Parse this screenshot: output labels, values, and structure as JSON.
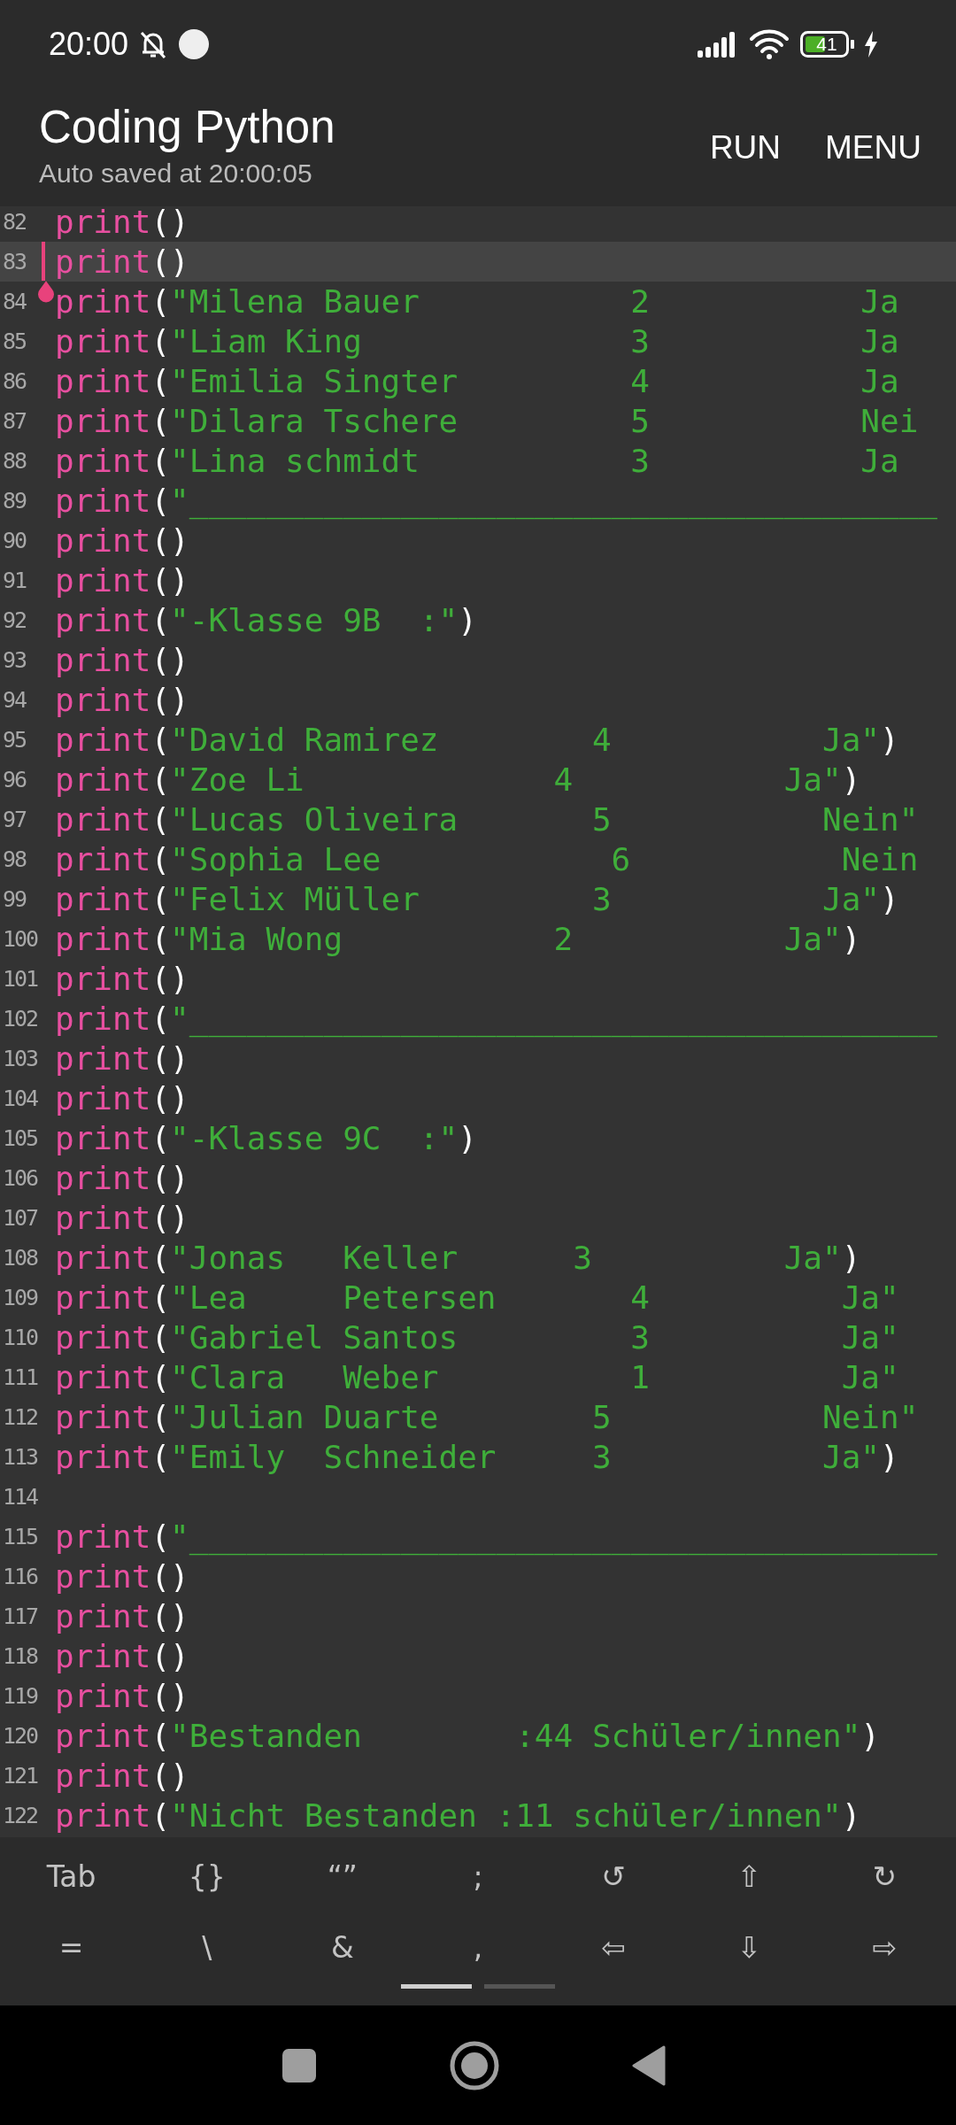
{
  "status_bar": {
    "time": "20:00",
    "battery": "41"
  },
  "app_bar": {
    "title": "Coding Python",
    "subtitle": "Auto saved at 20:00:05",
    "actions": [
      "RUN",
      "MENU"
    ]
  },
  "editor": {
    "lines": [
      {
        "number": "82",
        "current": false,
        "tokens": [
          {
            "kind": "keyword",
            "text": "print"
          },
          {
            "kind": "punct",
            "text": "()"
          }
        ]
      },
      {
        "number": "83",
        "current": true,
        "tokens": [
          {
            "kind": "keyword",
            "text": "print"
          },
          {
            "kind": "punct",
            "text": "()"
          }
        ]
      },
      {
        "number": "84",
        "current": false,
        "tokens": [
          {
            "kind": "keyword",
            "text": "print"
          },
          {
            "kind": "punct",
            "text": "("
          },
          {
            "kind": "string",
            "text": "\"Milena Bauer           2           Ja"
          }
        ]
      },
      {
        "number": "85",
        "current": false,
        "tokens": [
          {
            "kind": "keyword",
            "text": "print"
          },
          {
            "kind": "punct",
            "text": "("
          },
          {
            "kind": "string",
            "text": "\"Liam King              3           Ja"
          }
        ]
      },
      {
        "number": "86",
        "current": false,
        "tokens": [
          {
            "kind": "keyword",
            "text": "print"
          },
          {
            "kind": "punct",
            "text": "("
          },
          {
            "kind": "string",
            "text": "\"Emilia Singter         4           Ja"
          }
        ]
      },
      {
        "number": "87",
        "current": false,
        "tokens": [
          {
            "kind": "keyword",
            "text": "print"
          },
          {
            "kind": "punct",
            "text": "("
          },
          {
            "kind": "string",
            "text": "\"Dilara Tschere         5           Nei"
          }
        ]
      },
      {
        "number": "88",
        "current": false,
        "tokens": [
          {
            "kind": "keyword",
            "text": "print"
          },
          {
            "kind": "punct",
            "text": "("
          },
          {
            "kind": "string",
            "text": "\"Lina schmidt           3           Ja"
          }
        ]
      },
      {
        "number": "89",
        "current": false,
        "tokens": [
          {
            "kind": "keyword",
            "text": "print"
          },
          {
            "kind": "punct",
            "text": "("
          },
          {
            "kind": "string",
            "text": "\"_______________________________________"
          }
        ]
      },
      {
        "number": "90",
        "current": false,
        "tokens": [
          {
            "kind": "keyword",
            "text": "print"
          },
          {
            "kind": "punct",
            "text": "()"
          }
        ]
      },
      {
        "number": "91",
        "current": false,
        "tokens": [
          {
            "kind": "keyword",
            "text": "print"
          },
          {
            "kind": "punct",
            "text": "()"
          }
        ]
      },
      {
        "number": "92",
        "current": false,
        "tokens": [
          {
            "kind": "keyword",
            "text": "print"
          },
          {
            "kind": "punct",
            "text": "("
          },
          {
            "kind": "string",
            "text": "\"-Klasse 9B  :\""
          },
          {
            "kind": "punct",
            "text": ")"
          }
        ]
      },
      {
        "number": "93",
        "current": false,
        "tokens": [
          {
            "kind": "keyword",
            "text": "print"
          },
          {
            "kind": "punct",
            "text": "()"
          }
        ]
      },
      {
        "number": "94",
        "current": false,
        "tokens": [
          {
            "kind": "keyword",
            "text": "print"
          },
          {
            "kind": "punct",
            "text": "()"
          }
        ]
      },
      {
        "number": "95",
        "current": false,
        "tokens": [
          {
            "kind": "keyword",
            "text": "print"
          },
          {
            "kind": "punct",
            "text": "("
          },
          {
            "kind": "string",
            "text": "\"David Ramirez        4           Ja\""
          },
          {
            "kind": "punct",
            "text": ")"
          }
        ]
      },
      {
        "number": "96",
        "current": false,
        "tokens": [
          {
            "kind": "keyword",
            "text": "print"
          },
          {
            "kind": "punct",
            "text": "("
          },
          {
            "kind": "string",
            "text": "\"Zoe Li             4           Ja\""
          },
          {
            "kind": "punct",
            "text": ")"
          }
        ]
      },
      {
        "number": "97",
        "current": false,
        "tokens": [
          {
            "kind": "keyword",
            "text": "print"
          },
          {
            "kind": "punct",
            "text": "("
          },
          {
            "kind": "string",
            "text": "\"Lucas Oliveira       5           Nein\""
          }
        ]
      },
      {
        "number": "98",
        "current": false,
        "tokens": [
          {
            "kind": "keyword",
            "text": "print"
          },
          {
            "kind": "punct",
            "text": "("
          },
          {
            "kind": "string",
            "text": "\"Sophia Lee            6           Nein"
          }
        ]
      },
      {
        "number": "99",
        "current": false,
        "tokens": [
          {
            "kind": "keyword",
            "text": "print"
          },
          {
            "kind": "punct",
            "text": "("
          },
          {
            "kind": "string",
            "text": "\"Felix Müller         3           Ja\""
          },
          {
            "kind": "punct",
            "text": ")"
          }
        ]
      },
      {
        "number": "100",
        "current": false,
        "tokens": [
          {
            "kind": "keyword",
            "text": "print"
          },
          {
            "kind": "punct",
            "text": "("
          },
          {
            "kind": "string",
            "text": "\"Mia Wong           2           Ja\""
          },
          {
            "kind": "punct",
            "text": ")"
          }
        ]
      },
      {
        "number": "101",
        "current": false,
        "tokens": [
          {
            "kind": "keyword",
            "text": "print"
          },
          {
            "kind": "punct",
            "text": "()"
          }
        ]
      },
      {
        "number": "102",
        "current": false,
        "tokens": [
          {
            "kind": "keyword",
            "text": "print"
          },
          {
            "kind": "punct",
            "text": "("
          },
          {
            "kind": "string",
            "text": "\"_______________________________________"
          }
        ]
      },
      {
        "number": "103",
        "current": false,
        "tokens": [
          {
            "kind": "keyword",
            "text": "print"
          },
          {
            "kind": "punct",
            "text": "()"
          }
        ]
      },
      {
        "number": "104",
        "current": false,
        "tokens": [
          {
            "kind": "keyword",
            "text": "print"
          },
          {
            "kind": "punct",
            "text": "()"
          }
        ]
      },
      {
        "number": "105",
        "current": false,
        "tokens": [
          {
            "kind": "keyword",
            "text": "print"
          },
          {
            "kind": "punct",
            "text": "("
          },
          {
            "kind": "string",
            "text": "\"-Klasse 9C  :\""
          },
          {
            "kind": "punct",
            "text": ")"
          }
        ]
      },
      {
        "number": "106",
        "current": false,
        "tokens": [
          {
            "kind": "keyword",
            "text": "print"
          },
          {
            "kind": "punct",
            "text": "()"
          }
        ]
      },
      {
        "number": "107",
        "current": false,
        "tokens": [
          {
            "kind": "keyword",
            "text": "print"
          },
          {
            "kind": "punct",
            "text": "()"
          }
        ]
      },
      {
        "number": "108",
        "current": false,
        "tokens": [
          {
            "kind": "keyword",
            "text": "print"
          },
          {
            "kind": "punct",
            "text": "("
          },
          {
            "kind": "string",
            "text": "\"Jonas   Keller      3          Ja\""
          },
          {
            "kind": "punct",
            "text": ")"
          }
        ]
      },
      {
        "number": "109",
        "current": false,
        "tokens": [
          {
            "kind": "keyword",
            "text": "print"
          },
          {
            "kind": "punct",
            "text": "("
          },
          {
            "kind": "string",
            "text": "\"Lea     Petersen       4          Ja\""
          }
        ]
      },
      {
        "number": "110",
        "current": false,
        "tokens": [
          {
            "kind": "keyword",
            "text": "print"
          },
          {
            "kind": "punct",
            "text": "("
          },
          {
            "kind": "string",
            "text": "\"Gabriel Santos         3          Ja\""
          }
        ]
      },
      {
        "number": "111",
        "current": false,
        "tokens": [
          {
            "kind": "keyword",
            "text": "print"
          },
          {
            "kind": "punct",
            "text": "("
          },
          {
            "kind": "string",
            "text": "\"Clara   Weber          1          Ja\""
          }
        ]
      },
      {
        "number": "112",
        "current": false,
        "tokens": [
          {
            "kind": "keyword",
            "text": "print"
          },
          {
            "kind": "punct",
            "text": "("
          },
          {
            "kind": "string",
            "text": "\"Julian Duarte        5           Nein\""
          }
        ]
      },
      {
        "number": "113",
        "current": false,
        "tokens": [
          {
            "kind": "keyword",
            "text": "print"
          },
          {
            "kind": "punct",
            "text": "("
          },
          {
            "kind": "string",
            "text": "\"Emily  Schneider     3           Ja\""
          },
          {
            "kind": "punct",
            "text": ")"
          }
        ]
      },
      {
        "number": "114",
        "current": false
      },
      {
        "number": "115",
        "current": false,
        "tokens": [
          {
            "kind": "keyword",
            "text": "print"
          },
          {
            "kind": "punct",
            "text": "("
          },
          {
            "kind": "string",
            "text": "\"_______________________________________"
          }
        ]
      },
      {
        "number": "116",
        "current": false,
        "tokens": [
          {
            "kind": "keyword",
            "text": "print"
          },
          {
            "kind": "punct",
            "text": "()"
          }
        ]
      },
      {
        "number": "117",
        "current": false,
        "tokens": [
          {
            "kind": "keyword",
            "text": "print"
          },
          {
            "kind": "punct",
            "text": "()"
          }
        ]
      },
      {
        "number": "118",
        "current": false,
        "tokens": [
          {
            "kind": "keyword",
            "text": "print"
          },
          {
            "kind": "punct",
            "text": "()"
          }
        ]
      },
      {
        "number": "119",
        "current": false,
        "tokens": [
          {
            "kind": "keyword",
            "text": "print"
          },
          {
            "kind": "punct",
            "text": "()"
          }
        ]
      },
      {
        "number": "120",
        "current": false,
        "tokens": [
          {
            "kind": "keyword",
            "text": "print"
          },
          {
            "kind": "punct",
            "text": "("
          },
          {
            "kind": "string",
            "text": "\"Bestanden        :44 Schüler/innen\""
          },
          {
            "kind": "punct",
            "text": ")"
          }
        ]
      },
      {
        "number": "121",
        "current": false,
        "tokens": [
          {
            "kind": "keyword",
            "text": "print"
          },
          {
            "kind": "punct",
            "text": "()"
          }
        ]
      },
      {
        "number": "122",
        "current": false,
        "tokens": [
          {
            "kind": "keyword",
            "text": "print"
          },
          {
            "kind": "punct",
            "text": "("
          },
          {
            "kind": "string",
            "text": "\"Nicht Bestanden :11 schüler/innen\""
          },
          {
            "kind": "punct",
            "text": ")"
          }
        ]
      }
    ]
  },
  "key_bar": {
    "rows": [
      [
        "Tab",
        "{}",
        "“”",
        ";",
        "↺",
        "⇧",
        "↻"
      ],
      [
        "=",
        "\\",
        "&",
        ",",
        "⇦",
        "⇩",
        "⇨"
      ]
    ],
    "pages": [
      {
        "selected": true
      },
      {
        "selected": false
      }
    ]
  }
}
